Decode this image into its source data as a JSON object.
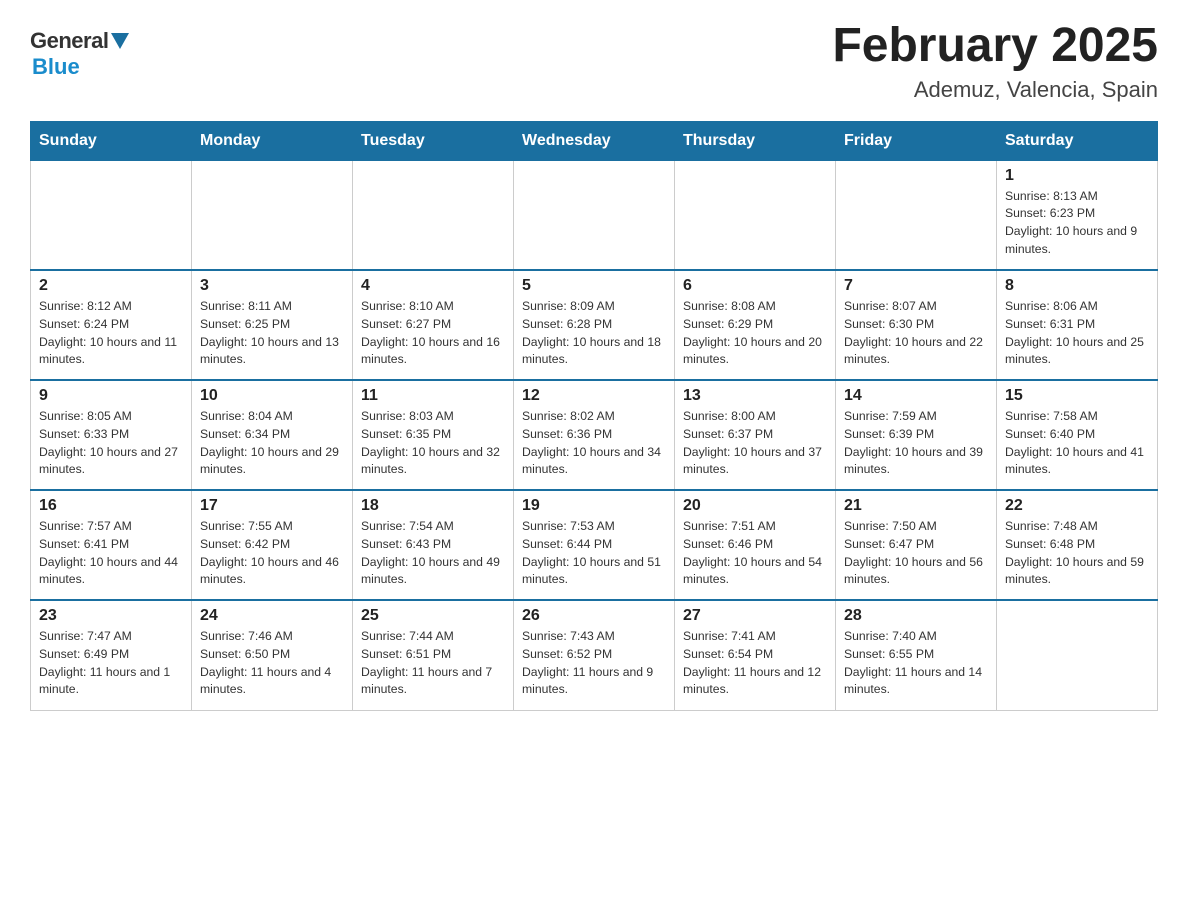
{
  "header": {
    "logo_general": "General",
    "logo_blue": "Blue",
    "month_title": "February 2025",
    "subtitle": "Ademuz, Valencia, Spain"
  },
  "days_of_week": [
    "Sunday",
    "Monday",
    "Tuesday",
    "Wednesday",
    "Thursday",
    "Friday",
    "Saturday"
  ],
  "weeks": [
    [
      {
        "day": "",
        "info": ""
      },
      {
        "day": "",
        "info": ""
      },
      {
        "day": "",
        "info": ""
      },
      {
        "day": "",
        "info": ""
      },
      {
        "day": "",
        "info": ""
      },
      {
        "day": "",
        "info": ""
      },
      {
        "day": "1",
        "info": "Sunrise: 8:13 AM\nSunset: 6:23 PM\nDaylight: 10 hours and 9 minutes."
      }
    ],
    [
      {
        "day": "2",
        "info": "Sunrise: 8:12 AM\nSunset: 6:24 PM\nDaylight: 10 hours and 11 minutes."
      },
      {
        "day": "3",
        "info": "Sunrise: 8:11 AM\nSunset: 6:25 PM\nDaylight: 10 hours and 13 minutes."
      },
      {
        "day": "4",
        "info": "Sunrise: 8:10 AM\nSunset: 6:27 PM\nDaylight: 10 hours and 16 minutes."
      },
      {
        "day": "5",
        "info": "Sunrise: 8:09 AM\nSunset: 6:28 PM\nDaylight: 10 hours and 18 minutes."
      },
      {
        "day": "6",
        "info": "Sunrise: 8:08 AM\nSunset: 6:29 PM\nDaylight: 10 hours and 20 minutes."
      },
      {
        "day": "7",
        "info": "Sunrise: 8:07 AM\nSunset: 6:30 PM\nDaylight: 10 hours and 22 minutes."
      },
      {
        "day": "8",
        "info": "Sunrise: 8:06 AM\nSunset: 6:31 PM\nDaylight: 10 hours and 25 minutes."
      }
    ],
    [
      {
        "day": "9",
        "info": "Sunrise: 8:05 AM\nSunset: 6:33 PM\nDaylight: 10 hours and 27 minutes."
      },
      {
        "day": "10",
        "info": "Sunrise: 8:04 AM\nSunset: 6:34 PM\nDaylight: 10 hours and 29 minutes."
      },
      {
        "day": "11",
        "info": "Sunrise: 8:03 AM\nSunset: 6:35 PM\nDaylight: 10 hours and 32 minutes."
      },
      {
        "day": "12",
        "info": "Sunrise: 8:02 AM\nSunset: 6:36 PM\nDaylight: 10 hours and 34 minutes."
      },
      {
        "day": "13",
        "info": "Sunrise: 8:00 AM\nSunset: 6:37 PM\nDaylight: 10 hours and 37 minutes."
      },
      {
        "day": "14",
        "info": "Sunrise: 7:59 AM\nSunset: 6:39 PM\nDaylight: 10 hours and 39 minutes."
      },
      {
        "day": "15",
        "info": "Sunrise: 7:58 AM\nSunset: 6:40 PM\nDaylight: 10 hours and 41 minutes."
      }
    ],
    [
      {
        "day": "16",
        "info": "Sunrise: 7:57 AM\nSunset: 6:41 PM\nDaylight: 10 hours and 44 minutes."
      },
      {
        "day": "17",
        "info": "Sunrise: 7:55 AM\nSunset: 6:42 PM\nDaylight: 10 hours and 46 minutes."
      },
      {
        "day": "18",
        "info": "Sunrise: 7:54 AM\nSunset: 6:43 PM\nDaylight: 10 hours and 49 minutes."
      },
      {
        "day": "19",
        "info": "Sunrise: 7:53 AM\nSunset: 6:44 PM\nDaylight: 10 hours and 51 minutes."
      },
      {
        "day": "20",
        "info": "Sunrise: 7:51 AM\nSunset: 6:46 PM\nDaylight: 10 hours and 54 minutes."
      },
      {
        "day": "21",
        "info": "Sunrise: 7:50 AM\nSunset: 6:47 PM\nDaylight: 10 hours and 56 minutes."
      },
      {
        "day": "22",
        "info": "Sunrise: 7:48 AM\nSunset: 6:48 PM\nDaylight: 10 hours and 59 minutes."
      }
    ],
    [
      {
        "day": "23",
        "info": "Sunrise: 7:47 AM\nSunset: 6:49 PM\nDaylight: 11 hours and 1 minute."
      },
      {
        "day": "24",
        "info": "Sunrise: 7:46 AM\nSunset: 6:50 PM\nDaylight: 11 hours and 4 minutes."
      },
      {
        "day": "25",
        "info": "Sunrise: 7:44 AM\nSunset: 6:51 PM\nDaylight: 11 hours and 7 minutes."
      },
      {
        "day": "26",
        "info": "Sunrise: 7:43 AM\nSunset: 6:52 PM\nDaylight: 11 hours and 9 minutes."
      },
      {
        "day": "27",
        "info": "Sunrise: 7:41 AM\nSunset: 6:54 PM\nDaylight: 11 hours and 12 minutes."
      },
      {
        "day": "28",
        "info": "Sunrise: 7:40 AM\nSunset: 6:55 PM\nDaylight: 11 hours and 14 minutes."
      },
      {
        "day": "",
        "info": ""
      }
    ]
  ]
}
